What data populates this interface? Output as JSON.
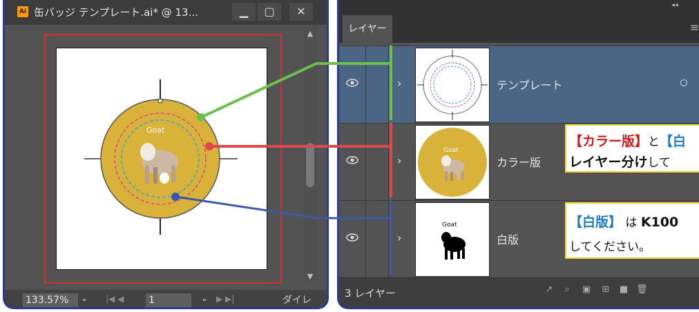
{
  "document_window": {
    "app_badge": "Ai",
    "title": "缶バッジ テンプレート.ai* @ 13...",
    "controls": {
      "minimize": "▁",
      "maximize": "▢",
      "close": "✕"
    },
    "zoom": "133.57%",
    "page": "1",
    "status_text": "ダイレ",
    "artwork": {
      "label": "Goat",
      "badge_color": "#d9b23a"
    }
  },
  "layers_panel": {
    "tab_label": "レイヤー",
    "layers": [
      {
        "name": "テンプレート",
        "selected": true,
        "color": "#6cbf4a"
      },
      {
        "name": "カラー版",
        "selected": false,
        "color": "#e0474c"
      },
      {
        "name": "白版",
        "selected": false,
        "color": "#3d58a8"
      }
    ],
    "footer_count": "3 レイヤー",
    "footer_icons": [
      "export-icon",
      "search-icon",
      "clip-icon",
      "new-sublayer-icon",
      "new-layer-icon",
      "trash-icon"
    ]
  },
  "callouts": {
    "color": {
      "line1_red": "【カラー版】",
      "line1_mid": "と",
      "line1_blue": "【白",
      "line2_bold": "レイヤー分け",
      "line2_rest": "して"
    },
    "white": {
      "line1_blue": "【白版】",
      "line1_mid": " は ",
      "line1_bold": "K100",
      "line2": "してください。"
    }
  },
  "colors": {
    "template": "#6cbf4a",
    "color_layer": "#e0474c",
    "white_layer": "#3d58a8",
    "frame": "#2b3a8c",
    "callout_border": "#f2d42a"
  }
}
